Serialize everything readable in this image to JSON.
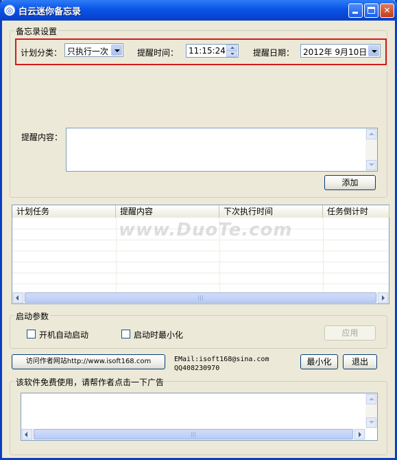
{
  "window": {
    "title": "白云迷你备忘录",
    "icon": "app-icon"
  },
  "settings": {
    "legend": "备忘录设置",
    "category_label": "计划分类：",
    "category_value": "只执行一次",
    "time_label": "提醒时间：",
    "time_value": "11:15:24",
    "date_label": "提醒日期：",
    "date_value": "2012年  9月10日",
    "content_label": "提醒内容：",
    "content_value": "",
    "add_button": "添加"
  },
  "task_list": {
    "columns": [
      "计划任务",
      "提醒内容",
      "下次执行时间",
      "任务倒计时"
    ],
    "rows": []
  },
  "startup": {
    "legend": "启动参数",
    "autostart_label": "开机自动启动",
    "autostart_checked": false,
    "minimize_label": "启动时最小化",
    "minimize_checked": false,
    "apply_button": "应用"
  },
  "footer": {
    "visit_button": "访问作者网站http://www.isoft168.com",
    "email_line": "EMail:isoft168@sina.com",
    "qq_line": "QQ408230970",
    "minimize_button": "最小化",
    "exit_button": "退出"
  },
  "ad": {
    "legend": "该软件免费使用，请帮作者点击一下广告"
  },
  "watermarks": {
    "center": "www.DuoTe.com"
  },
  "colors": {
    "title_bar": "#0a54e6",
    "highlight_box": "#d11b1b",
    "window_bg": "#ece9d8"
  }
}
